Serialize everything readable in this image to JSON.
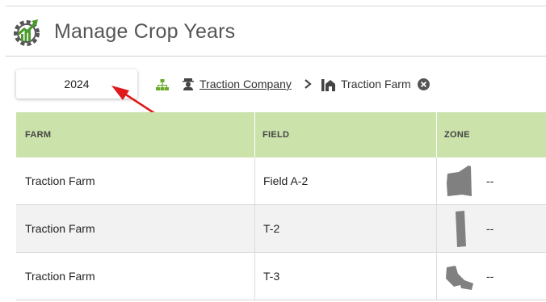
{
  "header": {
    "title": "Manage Crop Years",
    "logo_icon": "growth-gear-logo"
  },
  "year_selector": {
    "value": "2024"
  },
  "breadcrumb": {
    "org_icon": "org-hierarchy-icon",
    "company_icon": "farmer-icon",
    "company": "Traction Company",
    "separator_icon": "chevron-right-icon",
    "farm_icon": "farm-barn-icon",
    "farm": "Traction Farm",
    "clear_icon": "close-circle-icon"
  },
  "table": {
    "columns": [
      "FARM",
      "FIELD",
      "ZONE"
    ],
    "rows": [
      {
        "farm": "Traction Farm",
        "field": "Field A-2",
        "zone": "--"
      },
      {
        "farm": "Traction Farm",
        "field": "T-2",
        "zone": "--"
      },
      {
        "farm": "Traction Farm",
        "field": "T-3",
        "zone": "--"
      }
    ]
  },
  "colors": {
    "header_bg": "#cbe2ab",
    "logo_green": "#4a9a2c",
    "annotation_arrow": "#e0191b",
    "zone_shape": "#808080"
  }
}
